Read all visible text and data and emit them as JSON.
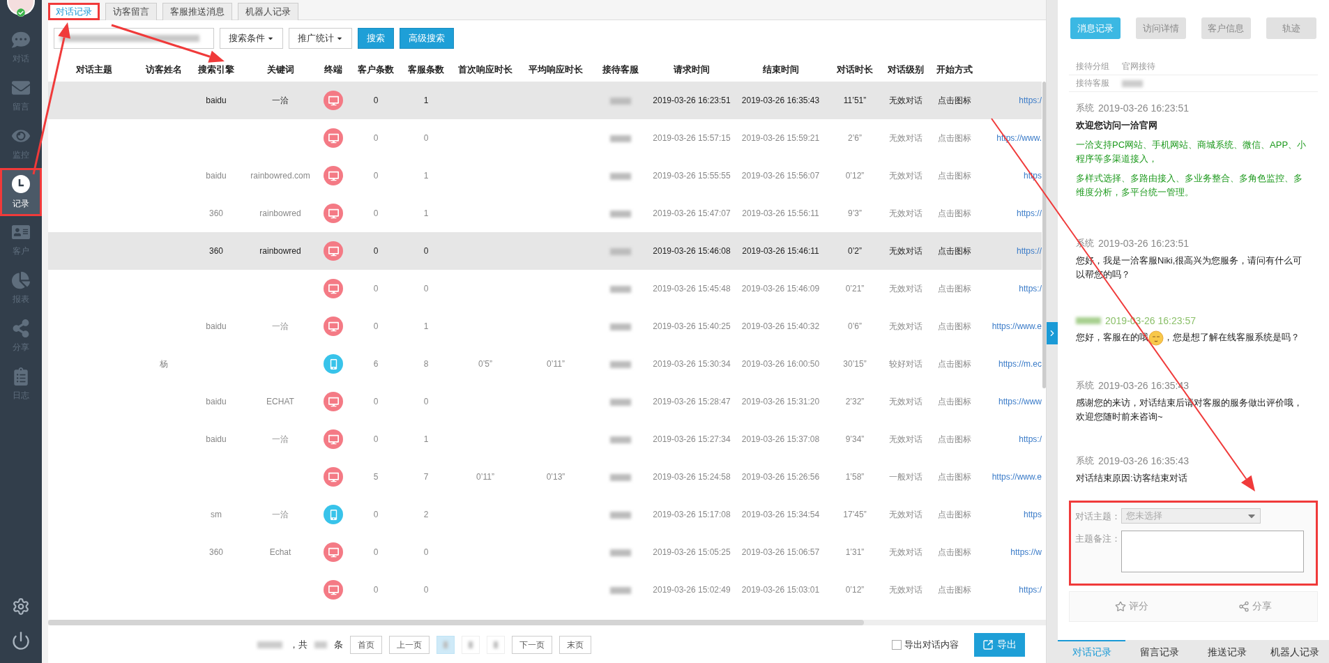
{
  "sidebar": {
    "items": [
      {
        "label": "对话",
        "selected": false,
        "annotated": false
      },
      {
        "label": "留言",
        "selected": false,
        "annotated": false
      },
      {
        "label": "监控",
        "selected": false,
        "annotated": false
      },
      {
        "label": "记录",
        "selected": true,
        "annotated": true
      },
      {
        "label": "客户",
        "selected": false,
        "annotated": false
      },
      {
        "label": "报表",
        "selected": false,
        "annotated": false
      },
      {
        "label": "分享",
        "selected": false,
        "annotated": false
      },
      {
        "label": "日志",
        "selected": false,
        "annotated": false
      }
    ]
  },
  "tabs": [
    {
      "label": "对话记录",
      "selected": true,
      "annotated": true
    },
    {
      "label": "访客留言",
      "selected": false,
      "annotated": false
    },
    {
      "label": "客服推送消息",
      "selected": false,
      "annotated": false
    },
    {
      "label": "机器人记录",
      "selected": false,
      "annotated": false
    }
  ],
  "toolbar": {
    "buttons": [
      {
        "label": "搜索条件",
        "kind": "dropdown"
      },
      {
        "label": "推广统计",
        "kind": "dropdown"
      },
      {
        "label": "搜索",
        "kind": "primary"
      },
      {
        "label": "高级搜索",
        "kind": "primary"
      }
    ]
  },
  "table": {
    "columns": [
      "对话主题",
      "访客姓名",
      "搜索引擎",
      "关键词",
      "终端",
      "客户条数",
      "客服条数",
      "首次响应时长",
      "平均响应时长",
      "接待客服",
      "请求时间",
      "结束时间",
      "对话时长",
      "对话级别",
      "开始方式"
    ],
    "rows": [
      {
        "kind": "pc",
        "selected": true,
        "engine": "baidu",
        "keyword": "一洽",
        "customer_count": "0",
        "agent_count": "1",
        "request_time": "2019-03-26 16:23:51",
        "end_time": "2019-03-26 16:35:43",
        "duration": "11’51”",
        "level": "无效对话",
        "start": "点击图标",
        "column_16": "https:/"
      },
      {
        "kind": "pc",
        "selected": false,
        "customer_count": "0",
        "agent_count": "0",
        "request_time": "2019-03-26 15:57:15",
        "end_time": "2019-03-26 15:59:21",
        "duration": "2’6”",
        "level": "无效对话",
        "start": "点击图标",
        "column_16": "https://www."
      },
      {
        "kind": "pc",
        "selected": false,
        "engine": "baidu",
        "keyword": "rainbowred.com",
        "customer_count": "0",
        "agent_count": "1",
        "request_time": "2019-03-26 15:55:55",
        "end_time": "2019-03-26 15:56:07",
        "duration": "0’12”",
        "level": "无效对话",
        "start": "点击图标",
        "column_16": "https"
      },
      {
        "kind": "pc",
        "selected": false,
        "engine": "360",
        "keyword": "rainbowred",
        "customer_count": "0",
        "agent_count": "1",
        "request_time": "2019-03-26 15:47:07",
        "end_time": "2019-03-26 15:56:11",
        "duration": "9’3”",
        "level": "无效对话",
        "start": "点击图标",
        "column_16": "https://"
      },
      {
        "kind": "pc",
        "selected": true,
        "engine": "360",
        "keyword": "rainbowred",
        "customer_count": "0",
        "agent_count": "0",
        "request_time": "2019-03-26 15:46:08",
        "end_time": "2019-03-26 15:46:11",
        "duration": "0’2”",
        "level": "无效对话",
        "start": "点击图标",
        "column_16": "https://"
      },
      {
        "kind": "pc",
        "selected": false,
        "customer_count": "0",
        "agent_count": "0",
        "request_time": "2019-03-26 15:45:48",
        "end_time": "2019-03-26 15:46:09",
        "duration": "0’21”",
        "level": "无效对话",
        "start": "点击图标",
        "column_16": "https:/"
      },
      {
        "kind": "pc",
        "selected": false,
        "engine": "baidu",
        "keyword": "一洽",
        "customer_count": "0",
        "agent_count": "1",
        "request_time": "2019-03-26 15:40:25",
        "end_time": "2019-03-26 15:40:32",
        "duration": "0’6”",
        "level": "无效对话",
        "start": "点击图标",
        "column_16": "https://www.e"
      },
      {
        "kind": "mobile",
        "selected": false,
        "visitor": "杨",
        "customer_count": "6",
        "agent_count": "8",
        "first_response": "0’5”",
        "avg_response": "0’11”",
        "request_time": "2019-03-26 15:30:34",
        "end_time": "2019-03-26 16:00:50",
        "duration": "30’15”",
        "level": "较好对话",
        "start": "点击图标",
        "column_16": "https://m.ec"
      },
      {
        "kind": "pc",
        "selected": false,
        "engine": "baidu",
        "keyword": "ECHAT",
        "customer_count": "0",
        "agent_count": "0",
        "request_time": "2019-03-26 15:28:47",
        "end_time": "2019-03-26 15:31:20",
        "duration": "2’32”",
        "level": "无效对话",
        "start": "点击图标",
        "column_16": "https://www"
      },
      {
        "kind": "pc",
        "selected": false,
        "engine": "baidu",
        "keyword": "一洽",
        "customer_count": "0",
        "agent_count": "1",
        "request_time": "2019-03-26 15:27:34",
        "end_time": "2019-03-26 15:37:08",
        "duration": "9’34”",
        "level": "无效对话",
        "start": "点击图标",
        "column_16": "https:/"
      },
      {
        "kind": "pc",
        "selected": false,
        "customer_count": "5",
        "agent_count": "7",
        "first_response": "0’11”",
        "avg_response": "0’13”",
        "request_time": "2019-03-26 15:24:58",
        "end_time": "2019-03-26 15:26:56",
        "duration": "1’58”",
        "level": "一般对话",
        "start": "点击图标",
        "column_16": "https://www.e"
      },
      {
        "kind": "mobile",
        "selected": false,
        "engine": "sm",
        "keyword": "一洽",
        "customer_count": "0",
        "agent_count": "2",
        "request_time": "2019-03-26 15:17:08",
        "end_time": "2019-03-26 15:34:54",
        "duration": "17’45”",
        "level": "无效对话",
        "start": "点击图标",
        "column_16": "https"
      },
      {
        "kind": "pc",
        "selected": false,
        "engine": "360",
        "keyword": "Echat",
        "customer_count": "0",
        "agent_count": "0",
        "request_time": "2019-03-26 15:05:25",
        "end_time": "2019-03-26 15:06:57",
        "duration": "1’31”",
        "level": "无效对话",
        "start": "点击图标",
        "column_16": "https://w"
      },
      {
        "kind": "pc",
        "selected": false,
        "customer_count": "0",
        "agent_count": "0",
        "request_time": "2019-03-26 15:02:49",
        "end_time": "2019-03-26 15:03:01",
        "duration": "0’12”",
        "level": "无效对话",
        "start": "点击图标",
        "column_16": "https:/"
      }
    ]
  },
  "pagination": {
    "summary_before": "，共",
    "summary_after": "条",
    "first": "首页",
    "prev": "上一页",
    "pages": [
      {
        "selected": true
      },
      {
        "selected": false
      },
      {
        "selected": false
      }
    ],
    "next": "下一页",
    "last": "末页"
  },
  "export": {
    "checkbox": {
      "label": "导出对话内容",
      "checked": false
    },
    "button": "导出"
  },
  "right_panel": {
    "tabs": [
      {
        "label": "消息记录",
        "selected": true
      },
      {
        "label": "访问详情",
        "selected": false
      },
      {
        "label": "客户信息",
        "selected": false
      },
      {
        "label": "轨迹",
        "selected": false
      }
    ],
    "info": [
      {
        "label": "接待分组",
        "value": "官网接待"
      },
      {
        "label": "接待客服"
      }
    ],
    "messages": [
      {
        "kind": "system",
        "sender": "系统",
        "time": "2019-03-26 16:23:51",
        "paragraphs": [
          {
            "kind": "title",
            "segments": [
              {
                "kind": "text",
                "text": "欢迎您访问一洽官网"
              }
            ]
          },
          {
            "kind": "highlight",
            "segments": [
              {
                "kind": "text",
                "text": "一洽支持PC网站、手机网站、商城系统、微信、APP、小程序等多渠道接入，"
              }
            ]
          },
          {
            "kind": "highlight",
            "segments": [
              {
                "kind": "text",
                "text": "多样式选择、多路由接入、多业务整合、多角色监控、多维度分析，多平台统一管理。"
              }
            ]
          }
        ]
      },
      {
        "kind": "system",
        "sender": "系统",
        "time": "2019-03-26 16:23:51",
        "paragraphs": [
          {
            "kind": "text",
            "segments": [
              {
                "kind": "text",
                "text": "您好，我是一洽客服Niki,很高兴为您服务，请问有什么可以帮您的吗？"
              }
            ]
          }
        ]
      },
      {
        "kind": "visitor",
        "time": "2019-03-26 16:23:57",
        "paragraphs": [
          {
            "kind": "text",
            "segments": [
              {
                "kind": "text",
                "text": "您好，客服在的哦"
              },
              {
                "kind": "emoji"
              },
              {
                "kind": "text",
                "text": "，您是想了解在线客服系统是吗？"
              }
            ]
          }
        ]
      },
      {
        "kind": "system",
        "sender": "系统",
        "time": "2019-03-26 16:35:43",
        "paragraphs": [
          {
            "kind": "text",
            "segments": [
              {
                "kind": "text",
                "text": "感谢您的来访，对话结束后请对客服的服务做出评价哦，欢迎您随时前来咨询~"
              }
            ]
          }
        ]
      },
      {
        "kind": "system",
        "sender": "系统",
        "time": "2019-03-26 16:35:43",
        "paragraphs": [
          {
            "kind": "text",
            "segments": [
              {
                "kind": "text",
                "text": "对话结束原因:访客结束对话"
              }
            ]
          }
        ]
      }
    ],
    "form": {
      "annotated": true,
      "fields": [
        {
          "kind": "select",
          "label": "对话主题：",
          "placeholder": "您未选择"
        },
        {
          "kind": "textarea",
          "label": "主题备注："
        }
      ]
    },
    "actions": [
      {
        "label": "评分"
      },
      {
        "label": "分享"
      }
    ],
    "bottom_tabs": [
      {
        "label": "对话记录",
        "selected": true
      },
      {
        "label": "留言记录",
        "selected": false
      },
      {
        "label": "推送记录",
        "selected": false
      },
      {
        "label": "机器人记录",
        "selected": false
      }
    ]
  }
}
